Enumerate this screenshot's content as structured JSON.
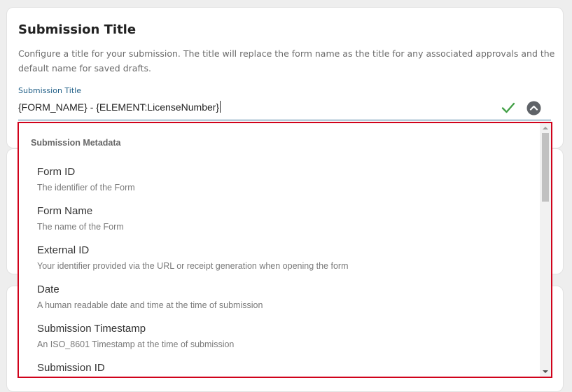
{
  "card": {
    "title": "Submission Title",
    "description": "Configure a title for your submission. The title will replace the form name as the title for any associated approvals and the default name for saved drafts."
  },
  "field": {
    "label": "Submission Title",
    "value": "{FORM_NAME} - {ELEMENT:LicenseNumber}",
    "confirm_icon": "check-icon",
    "toggle_icon": "chevron-up-icon"
  },
  "dropdown": {
    "header": "Submission Metadata",
    "items": [
      {
        "name": "Form ID",
        "description": "The identifier of the Form"
      },
      {
        "name": "Form Name",
        "description": "The name of the Form"
      },
      {
        "name": "External ID",
        "description": "Your identifier provided via the URL or receipt generation when opening the form"
      },
      {
        "name": "Date",
        "description": "A human readable date and time at the time of submission"
      },
      {
        "name": "Submission Timestamp",
        "description": "An ISO_8601 Timestamp at the time of submission"
      },
      {
        "name": "Submission ID",
        "description": ""
      }
    ]
  },
  "colors": {
    "highlight_border": "#d0021b",
    "label_blue": "#1f5e86",
    "check_green": "#43a047"
  }
}
